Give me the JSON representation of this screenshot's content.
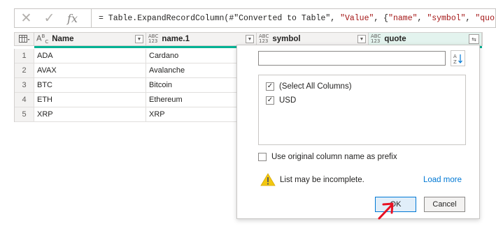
{
  "formula_bar": {
    "cancel_icon": "x-icon",
    "commit_icon": "check-icon",
    "fx_label": "fx",
    "prefix": "= Table.ExpandRecordColumn(#\"Converted to Table\", ",
    "arg_value": "\"Value\"",
    "sep1": ", {",
    "arg_name": "\"name\"",
    "sep2": ", ",
    "arg_symbol": "\"symbol\"",
    "sep3": ", ",
    "arg_quote": "\"quote\"",
    "suffix": "}"
  },
  "grid": {
    "columns": [
      {
        "label": "Name",
        "type": "ABC"
      },
      {
        "label": "name.1",
        "type": "ABC 123"
      },
      {
        "label": "symbol",
        "type": "ABC 123"
      },
      {
        "label": "quote",
        "type": "ABC 123"
      }
    ],
    "rows": [
      {
        "num": "1",
        "name": "ADA",
        "name1": "Cardano"
      },
      {
        "num": "2",
        "name": "AVAX",
        "name1": "Avalanche"
      },
      {
        "num": "3",
        "name": "BTC",
        "name1": "Bitcoin"
      },
      {
        "num": "4",
        "name": "ETH",
        "name1": "Ethereum"
      },
      {
        "num": "5",
        "name": "XRP",
        "name1": "XRP"
      }
    ]
  },
  "popup": {
    "search_value": "",
    "items": [
      {
        "label": "(Select All Columns)",
        "checked": true
      },
      {
        "label": "USD",
        "checked": true
      }
    ],
    "prefix_label": "Use original column name as prefix",
    "prefix_checked": false,
    "warning_text": "List may be incomplete.",
    "load_more": "Load more",
    "ok_label": "OK",
    "cancel_label": "Cancel"
  },
  "colors": {
    "accent": "#0078d4",
    "quality_bar": "#00b294",
    "warning": "#f2c811",
    "annotation_arrow": "#e81123"
  }
}
